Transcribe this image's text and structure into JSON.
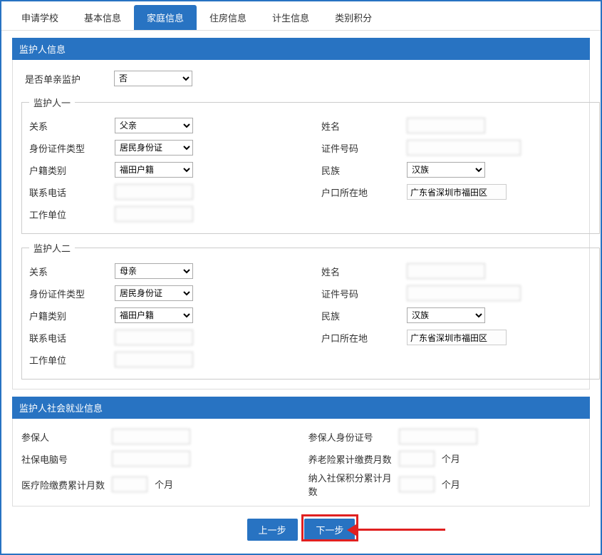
{
  "tabs": {
    "t0": "申请学校",
    "t1": "基本信息",
    "t2": "家庭信息",
    "t3": "住房信息",
    "t4": "计生信息",
    "t5": "类别积分"
  },
  "sections": {
    "guardian_info": "监护人信息",
    "social_info": "监护人社会就业信息"
  },
  "fields": {
    "single_parent_label": "是否单亲监护",
    "single_parent_value": "否",
    "guardian1_legend": "监护人一",
    "guardian2_legend": "监护人二",
    "relation": "关系",
    "relation_father": "父亲",
    "relation_mother": "母亲",
    "name": "姓名",
    "id_type": "身份证件类型",
    "id_type_value": "居民身份证",
    "id_number": "证件号码",
    "huji_type": "户籍类别",
    "huji_value": "福田户籍",
    "ethnic": "民族",
    "ethnic_value": "汉族",
    "phone": "联系电话",
    "huji_loc": "户口所在地",
    "huji_loc_value": "广东省深圳市福田区",
    "work_unit": "工作单位",
    "insured_person": "参保人",
    "insured_id": "参保人身份证号",
    "social_pc_no": "社保电脑号",
    "pension_months": "养老险累计缴费月数",
    "medical_months": "医疗险缴费累计月数",
    "social_score_months": "纳入社保积分累计月数",
    "month_unit": "个月"
  },
  "buttons": {
    "prev": "上一步",
    "next": "下一步"
  }
}
